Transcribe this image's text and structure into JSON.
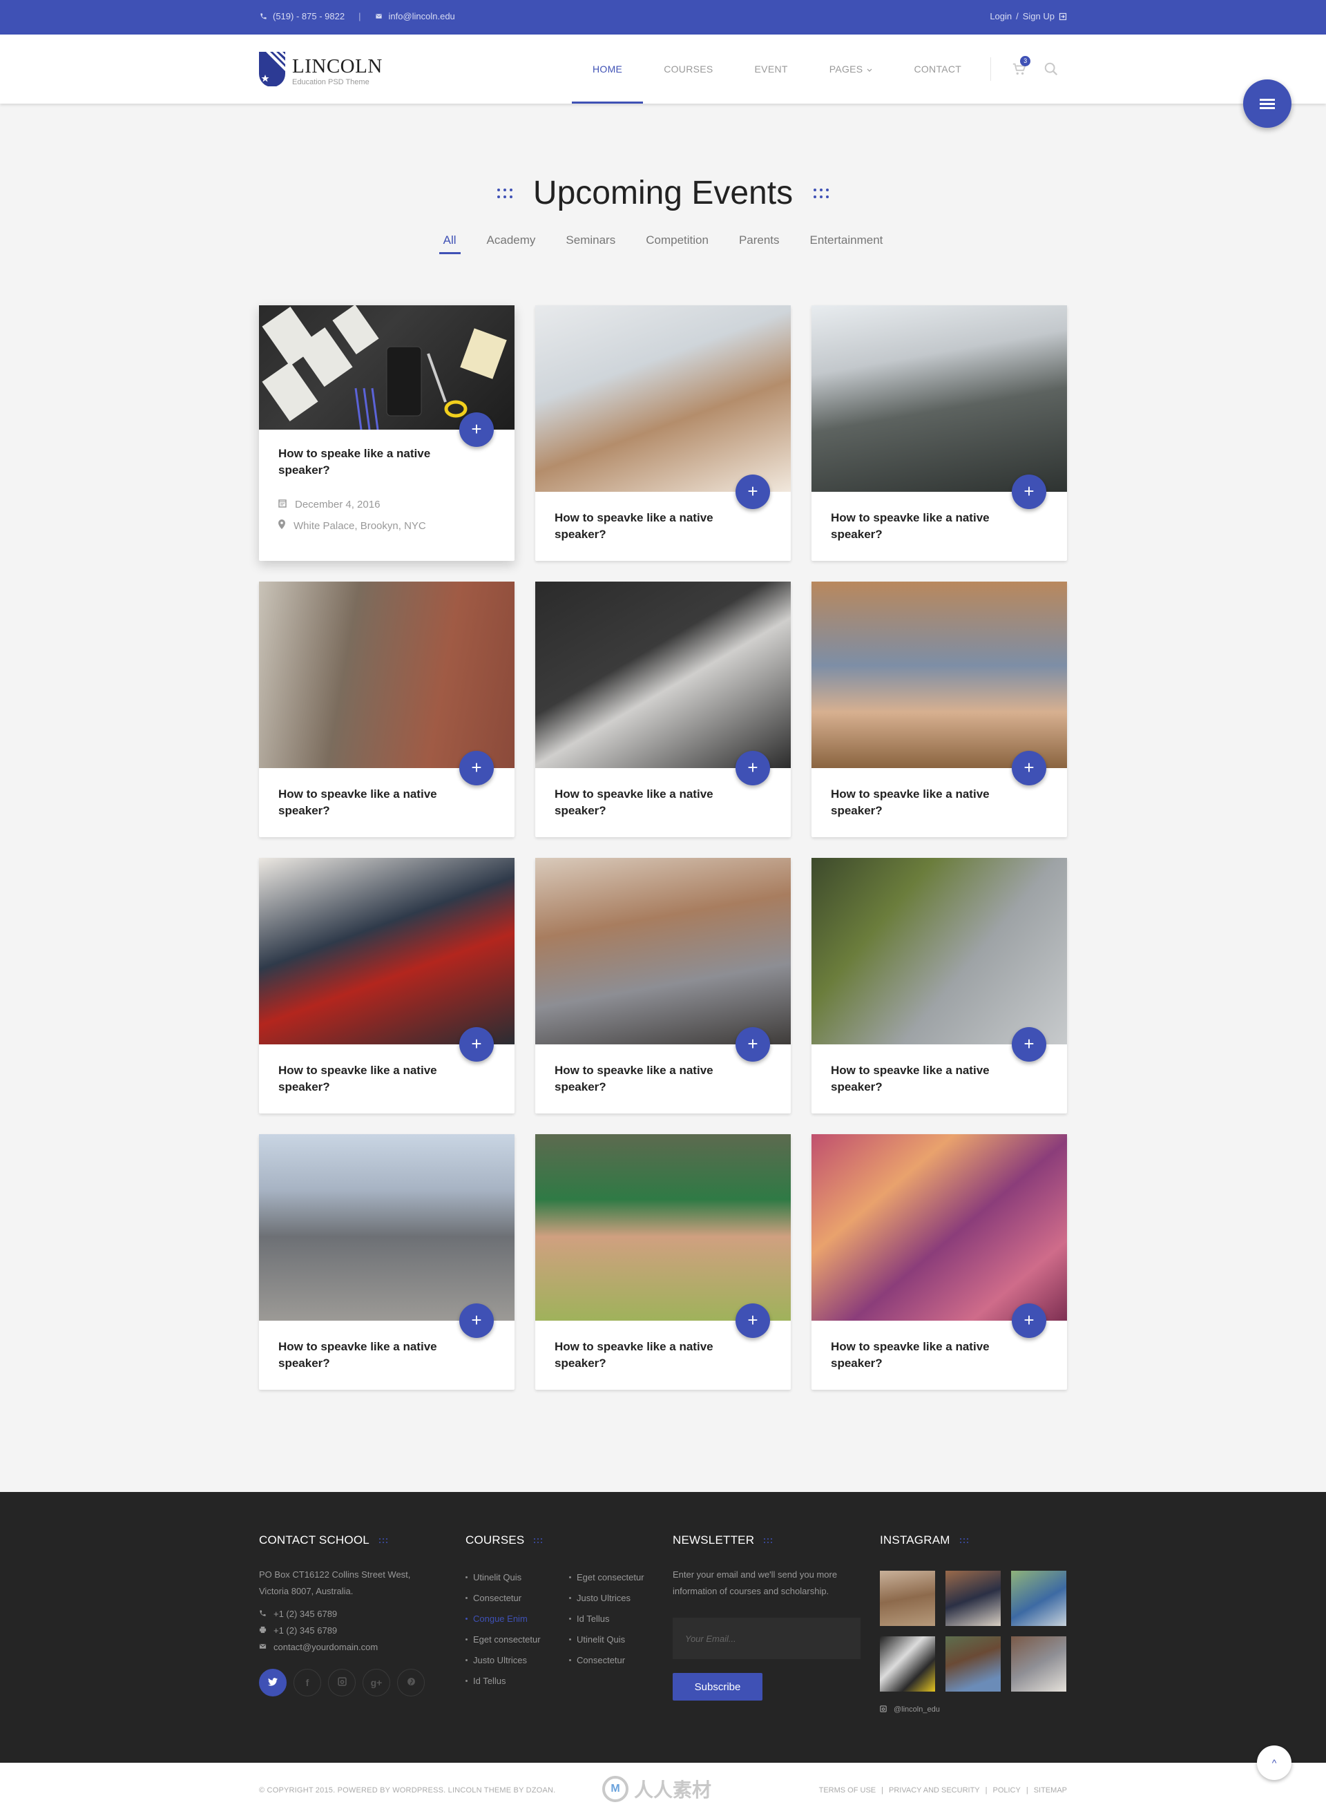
{
  "topbar": {
    "phone": "(519) - 875 - 9822",
    "separator": "|",
    "email": "info@lincoln.edu",
    "login_label": "Login",
    "signup_label": "Sign Up",
    "auth_separator": "/"
  },
  "header": {
    "logo_title": "LINCOLN",
    "logo_subtitle": "Education PSD Theme",
    "nav": [
      {
        "label": "HOME",
        "active": true
      },
      {
        "label": "COURSES",
        "active": false
      },
      {
        "label": "EVENT",
        "active": false
      },
      {
        "label": "PAGES",
        "active": false,
        "has_dropdown": true
      },
      {
        "label": "CONTACT",
        "active": false
      }
    ],
    "cart_count": "3",
    "icons": [
      "cart-icon",
      "search-icon",
      "menu-icon"
    ]
  },
  "colors": {
    "accent": "#3f51b5",
    "footer_bg": "#252525",
    "page_bg": "#f4f4f4"
  },
  "events": {
    "title": "Upcoming Events",
    "filters": [
      {
        "label": "All",
        "active": true
      },
      {
        "label": "Academy",
        "active": false
      },
      {
        "label": "Seminars",
        "active": false
      },
      {
        "label": "Competition",
        "active": false
      },
      {
        "label": "Parents",
        "active": false
      },
      {
        "label": "Entertainment",
        "active": false
      }
    ],
    "cards": [
      {
        "title": "How to speake like a native speaker?",
        "date": "December 4, 2016",
        "place": "White Palace, Brookyn, NYC",
        "image": "desk with wireframes, scissors and pencils"
      },
      {
        "title": "How to speavke like a native speaker?",
        "image": "students in classroom"
      },
      {
        "title": "How to speavke like a native speaker?",
        "image": "person running on treadmill"
      },
      {
        "title": "How to speavke like a native speaker?",
        "image": "student with backpack leaning on brick wall"
      },
      {
        "title": "How to speavke like a native speaker?",
        "image": "laptop and notebooks on desk"
      },
      {
        "title": "How to speavke like a native speaker?",
        "image": "students sitting on steps with laptop"
      },
      {
        "title": "How to speavke like a native speaker?",
        "image": "school orchestra students"
      },
      {
        "title": "How to speavke like a native speaker?",
        "image": "three smiling students"
      },
      {
        "title": "How to speavke like a native speaker?",
        "image": "aerial view of campus plaza"
      },
      {
        "title": "How to speavke like a native speaker?",
        "image": "modern stadium architecture"
      },
      {
        "title": "How to speavke like a native speaker?",
        "image": "football player in green jersey"
      },
      {
        "title": "How to speavke like a native speaker?",
        "image": "color festival crowd"
      }
    ],
    "plus_label": "+"
  },
  "footer": {
    "contact": {
      "heading": "CONTACT SCHOOL",
      "address_line1": "PO Box CT16122 Collins Street West,",
      "address_line2": "Victoria 8007, Australia.",
      "phone": "+1 (2) 345 6789",
      "fax": "+1 (2) 345 6789",
      "email": "contact@yourdomain.com",
      "socials": [
        {
          "name": "twitter",
          "glyph": "t",
          "active": true
        },
        {
          "name": "facebook",
          "glyph": "f",
          "active": false
        },
        {
          "name": "instagram",
          "glyph": "◘",
          "active": false
        },
        {
          "name": "google-plus",
          "glyph": "g+",
          "active": false
        },
        {
          "name": "pinterest",
          "glyph": "p",
          "active": false
        }
      ]
    },
    "courses": {
      "heading": "COURSES",
      "items": [
        {
          "label": "Utinelit Quis",
          "highlighted": false
        },
        {
          "label": "Eget consectetur",
          "highlighted": false
        },
        {
          "label": "Consectetur",
          "highlighted": false
        },
        {
          "label": "Justo Ultrices",
          "highlighted": false
        },
        {
          "label": "Congue Enim",
          "highlighted": true
        },
        {
          "label": "Id Tellus",
          "highlighted": false
        },
        {
          "label": "Eget consectetur",
          "highlighted": false
        },
        {
          "label": "Utinelit Quis",
          "highlighted": false
        },
        {
          "label": "Justo Ultrices",
          "highlighted": false
        },
        {
          "label": "Consectetur",
          "highlighted": false
        },
        {
          "label": "Id Tellus",
          "highlighted": false
        }
      ]
    },
    "newsletter": {
      "heading": "NEWSLETTER",
      "text_line1": "Enter your email and we'll send you more",
      "text_line2": "information of courses and scholarship.",
      "placeholder": "Your Email...",
      "button_label": "Subscribe"
    },
    "instagram": {
      "heading": "INSTAGRAM",
      "handle": "@lincoln_edu",
      "photos": [
        "students on steps",
        "student writing in library",
        "student with backpack",
        "desk with scissors",
        "smiling girl",
        "student writing"
      ]
    }
  },
  "bottombar": {
    "copyright": "© COPYRIGHT 2015. POWERED BY WORDPRESS. LINCOLN THEME BY DZOAN.",
    "watermark": "人人素材",
    "links": [
      "TERMS OF USE",
      "PRIVACY AND SECURITY",
      "POLICY",
      "SITEMAP"
    ],
    "link_separator": "|",
    "to_top_label": "^"
  }
}
